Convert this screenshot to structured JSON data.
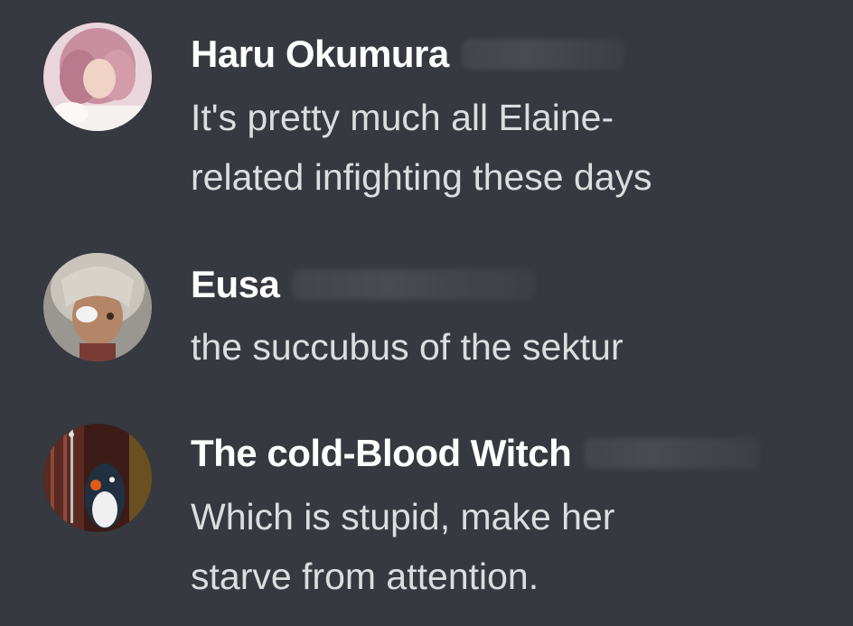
{
  "messages": [
    {
      "username": "Haru Okumura",
      "avatar_icon": "user-avatar-pink-hair",
      "text_lines": [
        "It's pretty much all Elaine-",
        "related infighting these days"
      ]
    },
    {
      "username": "Eusa",
      "avatar_icon": "user-avatar-grey-hair",
      "text_lines": [
        "the succubus of the sektur"
      ]
    },
    {
      "username": "The cold-Blood Witch",
      "avatar_icon": "user-avatar-penguin",
      "text_lines": [
        "Which is stupid, make her",
        "starve from attention."
      ]
    }
  ],
  "colors": {
    "background": "#36393f",
    "username": "#ffffff",
    "text": "#dcddde"
  }
}
